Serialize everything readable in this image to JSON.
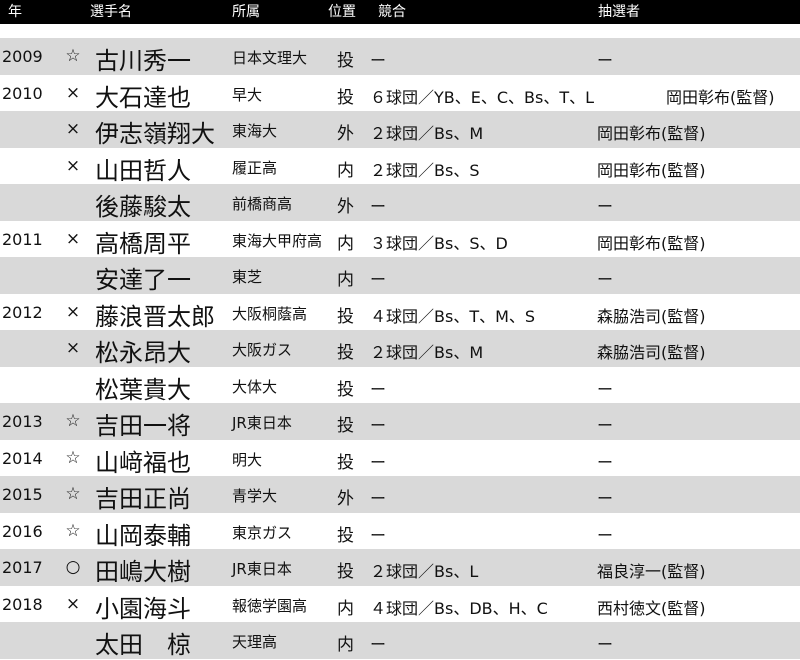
{
  "headers": {
    "year": "年",
    "name": "選手名",
    "team": "所属",
    "position": "位置",
    "competition": "競合",
    "drawer": "抽選者"
  },
  "rows": [
    {
      "year": "2009",
      "mark": "☆",
      "name": "古川秀一",
      "team": "日本文理大",
      "position": "投",
      "competition": "ー",
      "drawer": "ー"
    },
    {
      "year": "2010",
      "mark": "×",
      "name": "大石達也",
      "team": "早大",
      "position": "投",
      "competition": "６球団／YB、E、C、Bs、T、L",
      "drawer": "岡田彰布(監督)"
    },
    {
      "year": "",
      "mark": "×",
      "name": "伊志嶺翔大",
      "team": "東海大",
      "position": "外",
      "competition": "２球団／Bs、M",
      "drawer": "岡田彰布(監督)"
    },
    {
      "year": "",
      "mark": "×",
      "name": "山田哲人",
      "team": "履正高",
      "position": "内",
      "competition": "２球団／Bs、S",
      "drawer": "岡田彰布(監督)"
    },
    {
      "year": "",
      "mark": "",
      "name": "後藤駿太",
      "team": "前橋商高",
      "position": "外",
      "competition": "ー",
      "drawer": "ー"
    },
    {
      "year": "2011",
      "mark": "×",
      "name": "高橋周平",
      "team": "東海大甲府高",
      "position": "内",
      "competition": "３球団／Bs、S、D",
      "drawer": "岡田彰布(監督)"
    },
    {
      "year": "",
      "mark": "",
      "name": "安達了一",
      "team": "東芝",
      "position": "内",
      "competition": "ー",
      "drawer": "ー"
    },
    {
      "year": "2012",
      "mark": "×",
      "name": "藤浪晋太郎",
      "team": "大阪桐蔭高",
      "position": "投",
      "competition": "４球団／Bs、T、M、S",
      "drawer": "森脇浩司(監督)"
    },
    {
      "year": "",
      "mark": "×",
      "name": "松永昂大",
      "team": "大阪ガス",
      "position": "投",
      "competition": "２球団／Bs、M",
      "drawer": "森脇浩司(監督)"
    },
    {
      "year": "",
      "mark": "",
      "name": "松葉貴大",
      "team": "大体大",
      "position": "投",
      "competition": "ー",
      "drawer": "ー"
    },
    {
      "year": "2013",
      "mark": "☆",
      "name": "吉田一将",
      "team": "JR東日本",
      "position": "投",
      "competition": "ー",
      "drawer": "ー"
    },
    {
      "year": "2014",
      "mark": "☆",
      "name": "山﨑福也",
      "team": "明大",
      "position": "投",
      "competition": "ー",
      "drawer": "ー"
    },
    {
      "year": "2015",
      "mark": "☆",
      "name": "吉田正尚",
      "team": "青学大",
      "position": "外",
      "competition": "ー",
      "drawer": "ー"
    },
    {
      "year": "2016",
      "mark": "☆",
      "name": "山岡泰輔",
      "team": "東京ガス",
      "position": "投",
      "competition": "ー",
      "drawer": "ー"
    },
    {
      "year": "2017",
      "mark": "○",
      "name": "田嶋大樹",
      "team": "JR東日本",
      "position": "投",
      "competition": "２球団／Bs、L",
      "drawer": "福良淳一(監督)"
    },
    {
      "year": "2018",
      "mark": "×",
      "name": "小園海斗",
      "team": "報徳学園高",
      "position": "内",
      "competition": "４球団／Bs、DB、H、C",
      "drawer": "西村徳文(監督)"
    },
    {
      "year": "",
      "mark": "",
      "name": "太田　椋",
      "team": "天理高",
      "position": "内",
      "competition": "ー",
      "drawer": "ー"
    }
  ],
  "colors": {
    "header_bg": "#000000",
    "header_text": "#ffffff",
    "shade": "#d9d9d9",
    "plain": "#ffffff"
  }
}
